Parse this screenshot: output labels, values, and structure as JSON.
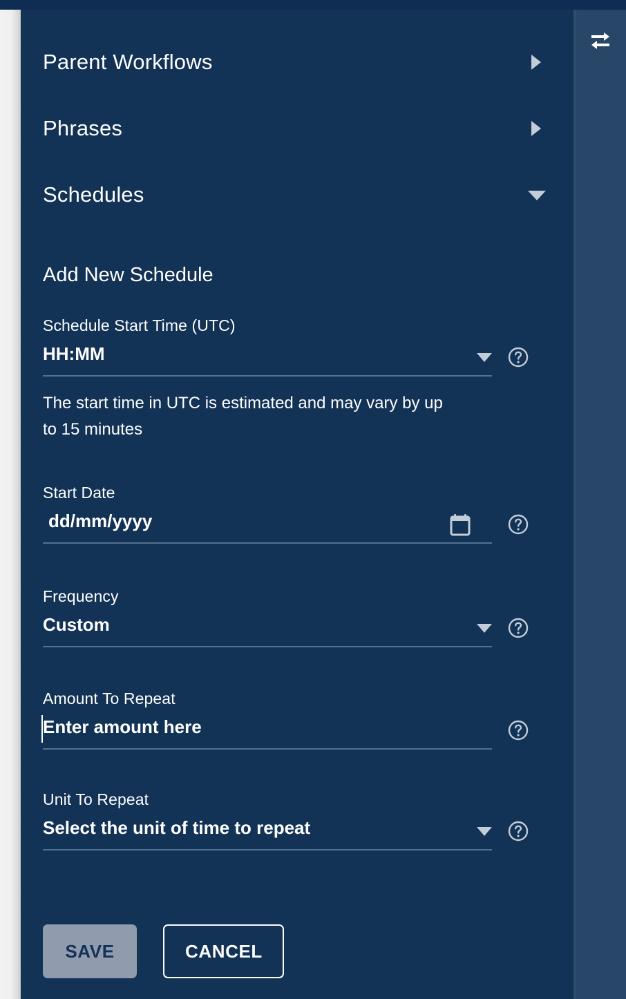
{
  "panel": {
    "swap_icon": "swap-horizontal-icon"
  },
  "accordion": {
    "items": [
      {
        "label": "Parent Workflows",
        "state": "collapsed",
        "icon": "chevron-right-icon"
      },
      {
        "label": "Phrases",
        "state": "collapsed",
        "icon": "chevron-right-icon"
      },
      {
        "label": "Schedules",
        "state": "expanded",
        "icon": "chevron-down-icon"
      }
    ]
  },
  "form": {
    "title": "Add New Schedule",
    "start_time": {
      "label": "Schedule Start Time (UTC)",
      "value": "HH:MM",
      "dropdown_icon": "chevron-down-icon",
      "help_icon": "help-circle-icon",
      "hint": "The start time in UTC is estimated and may vary by up to 15 minutes"
    },
    "start_date": {
      "label": "Start Date",
      "value": "dd/mm/yyyy",
      "calendar_icon": "calendar-icon",
      "help_icon": "help-circle-icon"
    },
    "frequency": {
      "label": "Frequency",
      "value": "Custom",
      "dropdown_icon": "chevron-down-icon",
      "help_icon": "help-circle-icon"
    },
    "amount_to_repeat": {
      "label": "Amount To Repeat",
      "placeholder": "Enter amount here",
      "value": "Enter amount here",
      "help_icon": "help-circle-icon"
    },
    "unit_to_repeat": {
      "label": "Unit To Repeat",
      "value": "Select the unit of time to repeat",
      "dropdown_icon": "chevron-down-icon",
      "help_icon": "help-circle-icon"
    },
    "actions": {
      "save_label": "SAVE",
      "cancel_label": "CANCEL"
    }
  },
  "colors": {
    "panel_bg": "#123256",
    "right_panel_bg": "#284668",
    "text": "#ffffff",
    "underline": "#56718f",
    "save_bg": "#909cad",
    "save_text": "#12325a",
    "arrow": "#c3cdd8"
  }
}
